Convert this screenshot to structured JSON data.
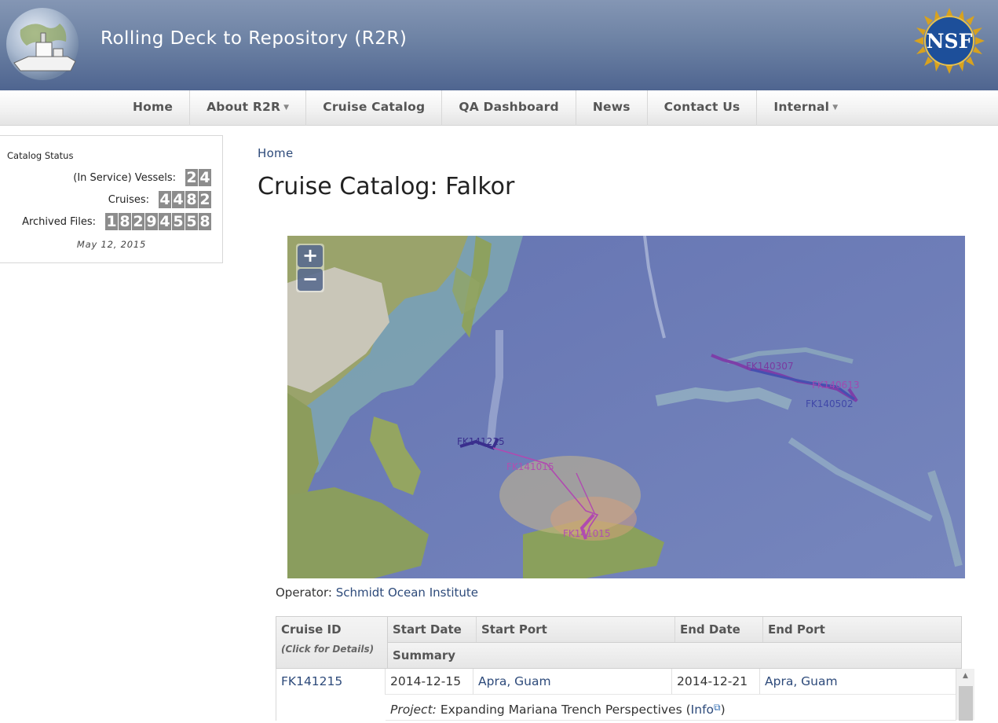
{
  "header": {
    "site_title": "Rolling Deck to Repository (R2R)"
  },
  "nav": [
    {
      "label": "Home",
      "dropdown": false
    },
    {
      "label": "About R2R",
      "dropdown": true
    },
    {
      "label": "Cruise Catalog",
      "dropdown": false
    },
    {
      "label": "QA Dashboard",
      "dropdown": false
    },
    {
      "label": "News",
      "dropdown": false
    },
    {
      "label": "Contact Us",
      "dropdown": false
    },
    {
      "label": "Internal",
      "dropdown": true
    }
  ],
  "status": {
    "title": "Catalog Status",
    "vessels_label": "(In Service) Vessels:",
    "vessels": "24",
    "cruises_label": "Cruises:",
    "cruises": "4482",
    "files_label": "Archived Files:",
    "files": "18294558",
    "date": "May 12, 2015"
  },
  "breadcrumb": "Home",
  "page_title": "Cruise Catalog: Falkor",
  "map": {
    "zoom_in": "+",
    "zoom_out": "−",
    "labels": [
      "FK140307",
      "FK140613",
      "FK140502",
      "FK141215",
      "FK141015",
      "FK141015"
    ]
  },
  "operator": {
    "label": "Operator:",
    "value": "Schmidt Ocean Institute"
  },
  "table": {
    "headers": {
      "cruise_id": "Cruise ID",
      "cruise_hint": "(Click for Details)",
      "start_date": "Start Date",
      "start_port": "Start Port",
      "end_date": "End Date",
      "end_port": "End Port",
      "summary": "Summary"
    },
    "rows": [
      {
        "id": "FK141215",
        "start_date": "2014-12-15",
        "start_port": "Apra, Guam",
        "end_date": "2014-12-21",
        "end_port": "Apra, Guam",
        "project_label": "Project:",
        "project": "Expanding Mariana Trench Perspectives",
        "info_open": "(",
        "info": "Info",
        "info_close": ")"
      }
    ]
  }
}
